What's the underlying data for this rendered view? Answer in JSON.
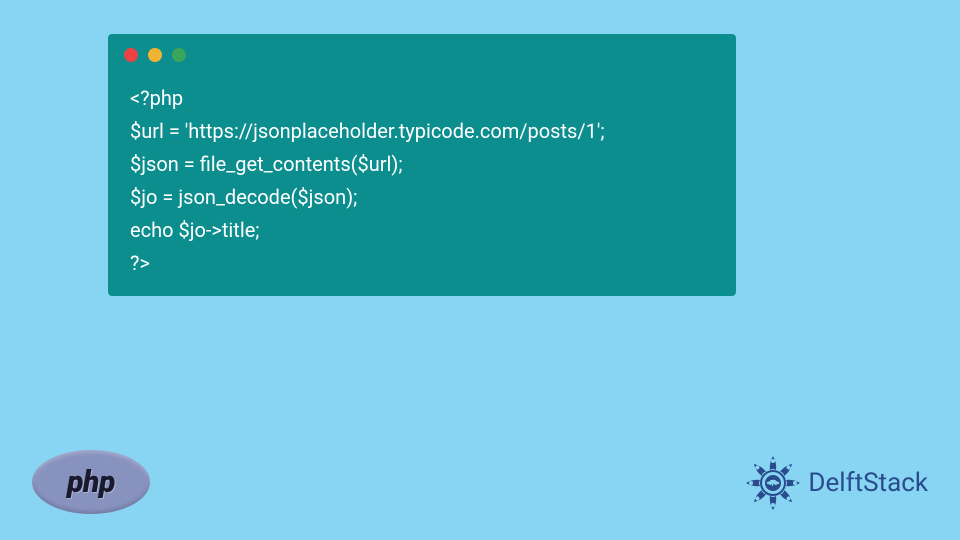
{
  "code": {
    "lines": [
      "<?php",
      "$url = 'https://jsonplaceholder.typicode.com/posts/1';",
      "$json = file_get_contents($url);",
      "$jo = json_decode($json);",
      "echo $jo->title;",
      "?>"
    ]
  },
  "logos": {
    "php": "php",
    "delft": "DelftStack"
  },
  "colors": {
    "background": "#87d5f2",
    "code_bg": "#0d8e8e",
    "code_text": "#ffffff",
    "php_bg": "#8892bf",
    "delft_text": "#2a4b8d"
  }
}
